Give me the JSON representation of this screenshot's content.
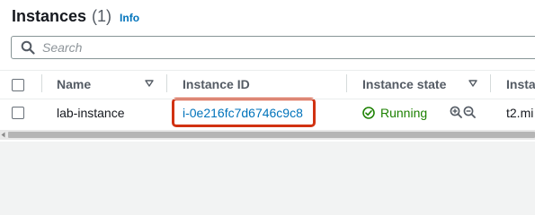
{
  "header": {
    "title": "Instances",
    "count": "(1)",
    "info_link": "Info"
  },
  "search": {
    "placeholder": "Search",
    "icon": "search-icon"
  },
  "table": {
    "columns": [
      "Name",
      "Instance ID",
      "Instance state",
      "Insta"
    ],
    "rows": [
      {
        "name": "lab-instance",
        "instance_id": "i-0e216fc7d6746c9c8",
        "state": "Running",
        "type": "t2.mi"
      }
    ]
  },
  "colors": {
    "link": "#0073bb",
    "running": "#1d8102",
    "highlight": "#d13212",
    "header_text": "#545b64"
  }
}
